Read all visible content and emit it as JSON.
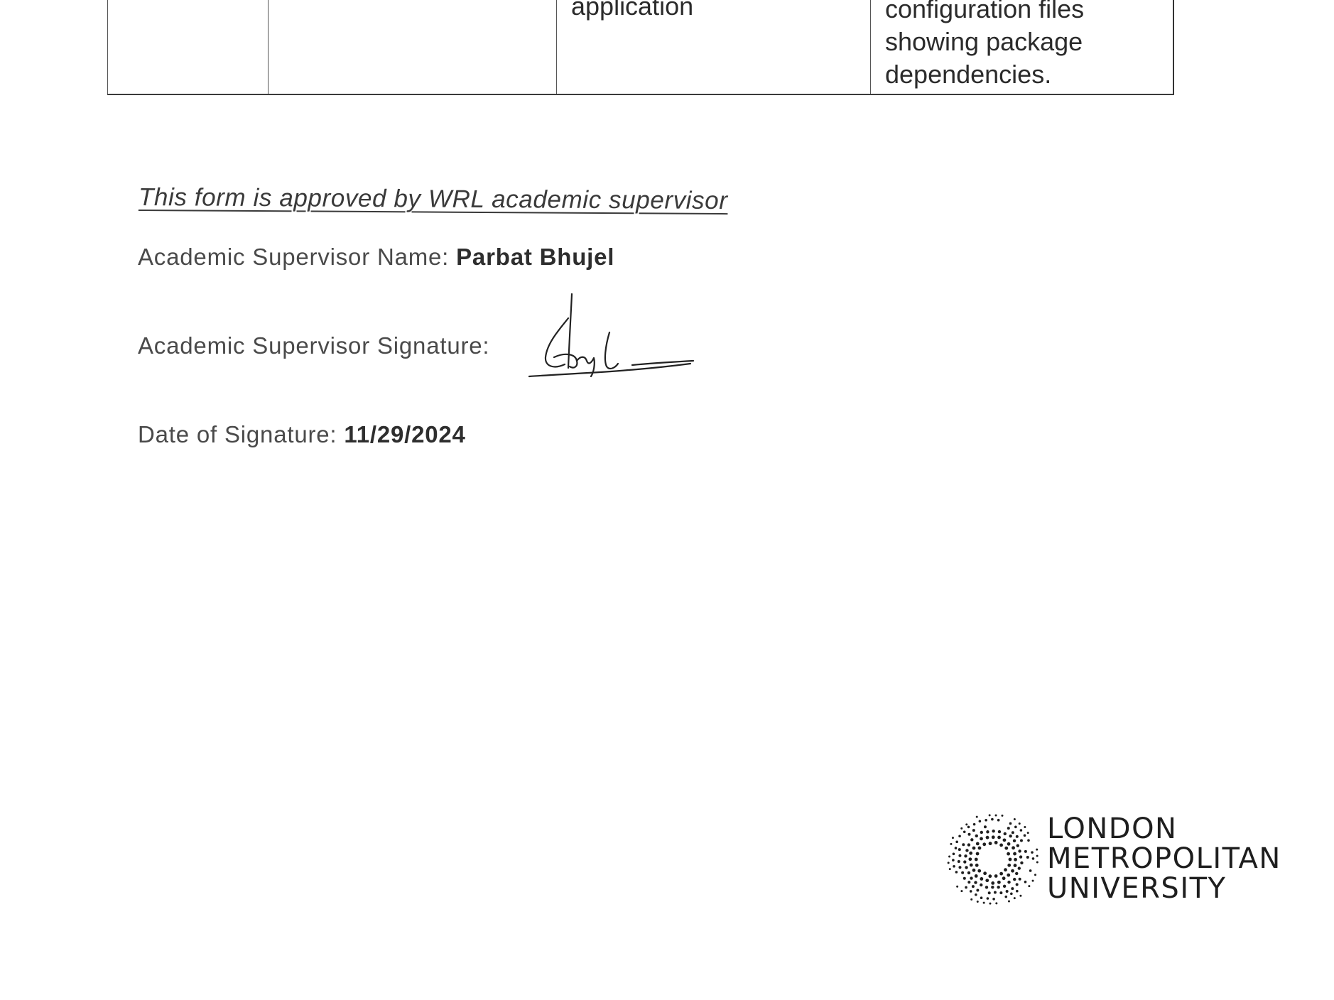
{
  "table_fragment": {
    "col3_lines": [
      "application"
    ],
    "col4_lines": [
      "configuration files",
      "showing package",
      "dependencies."
    ]
  },
  "approval": {
    "statement": "This form is approved by WRL academic supervisor",
    "name_label": "Academic Supervisor Name:",
    "name_value": "Parbat Bhujel",
    "signature_label": "Academic Supervisor Signature:",
    "date_label": "Date of Signature:",
    "date_value": "11/29/2024"
  },
  "logo": {
    "icon": "dotted-ring-logo-icon",
    "lines": [
      "LONDON",
      "METROPOLITAN",
      "UNIVERSITY"
    ]
  }
}
